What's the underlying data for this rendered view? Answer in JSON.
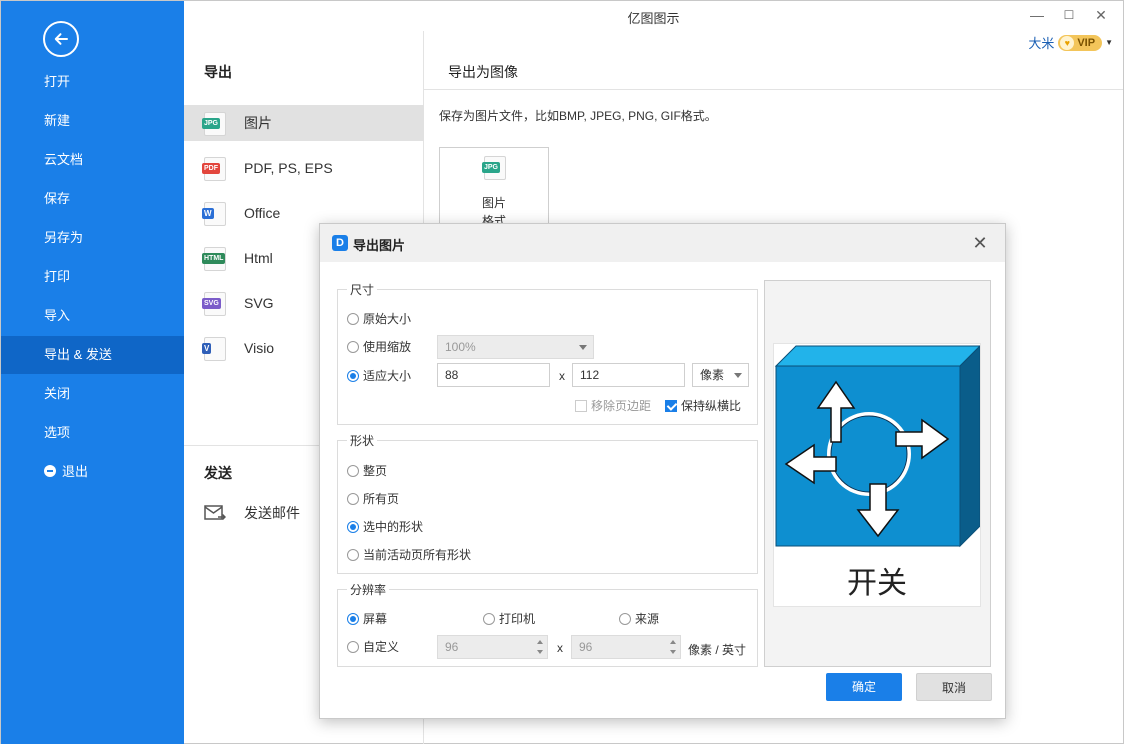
{
  "app": {
    "title": "亿图图示"
  },
  "window_controls": {
    "minimize": "—",
    "maximize": "☐",
    "close": "✕"
  },
  "user": {
    "name": "大米",
    "vip": "VIP"
  },
  "sidebar": {
    "items": [
      {
        "label": "打开"
      },
      {
        "label": "新建"
      },
      {
        "label": "云文档"
      },
      {
        "label": "保存"
      },
      {
        "label": "另存为"
      },
      {
        "label": "打印"
      },
      {
        "label": "导入"
      },
      {
        "label": "导出 & 发送"
      },
      {
        "label": "关闭"
      },
      {
        "label": "选项"
      },
      {
        "label": "退出"
      }
    ]
  },
  "export_panel": {
    "title": "导出",
    "items": [
      {
        "label": "图片",
        "icon_text": "JPG",
        "color": "#2aa58a"
      },
      {
        "label": "PDF, PS, EPS",
        "icon_text": "PDF",
        "color": "#e2453c"
      },
      {
        "label": "Office",
        "icon_text": "W",
        "color": "#2b6fd6"
      },
      {
        "label": "Html",
        "icon_text": "HTML",
        "color": "#2e8a5a"
      },
      {
        "label": "SVG",
        "icon_text": "SVG",
        "color": "#7b5cc9"
      },
      {
        "label": "Visio",
        "icon_text": "V",
        "color": "#2f5fb8"
      }
    ],
    "send_title": "发送",
    "send_mail": "发送邮件"
  },
  "content": {
    "heading": "导出为图像",
    "description": "保存为图片文件，比如BMP, JPEG, PNG, GIF格式。",
    "card_label": "图片",
    "card_sub": "格式"
  },
  "dialog": {
    "title": "导出图片",
    "size_group": {
      "label": "尺寸",
      "original": "原始大小",
      "use_scale": "使用缩放",
      "scale_value": "100%",
      "fit": "适应大小",
      "width": "88",
      "height": "112",
      "unit": "像素",
      "remove_margin": "移除页边距",
      "keep_ratio": "保持纵横比",
      "times": "x"
    },
    "shape_group": {
      "label": "形状",
      "whole_page": "整页",
      "all_pages": "所有页",
      "selected": "选中的形状",
      "current_page_all": "当前活动页所有形状"
    },
    "resolution_group": {
      "label": "分辨率",
      "screen": "屏幕",
      "printer": "打印机",
      "source": "来源",
      "custom": "自定义",
      "dpi_x": "96",
      "dpi_y": "96",
      "times": "x",
      "unit": "像素 / 英寸"
    },
    "preview_label": "开关",
    "ok": "确定",
    "cancel": "取消"
  },
  "colors": {
    "sidebar": "#1a7fe8",
    "sidebar_active": "#0f66c7",
    "switch_face": "#0e8fd0",
    "switch_top": "#22b3ea",
    "switch_side": "#0a5d8a"
  }
}
